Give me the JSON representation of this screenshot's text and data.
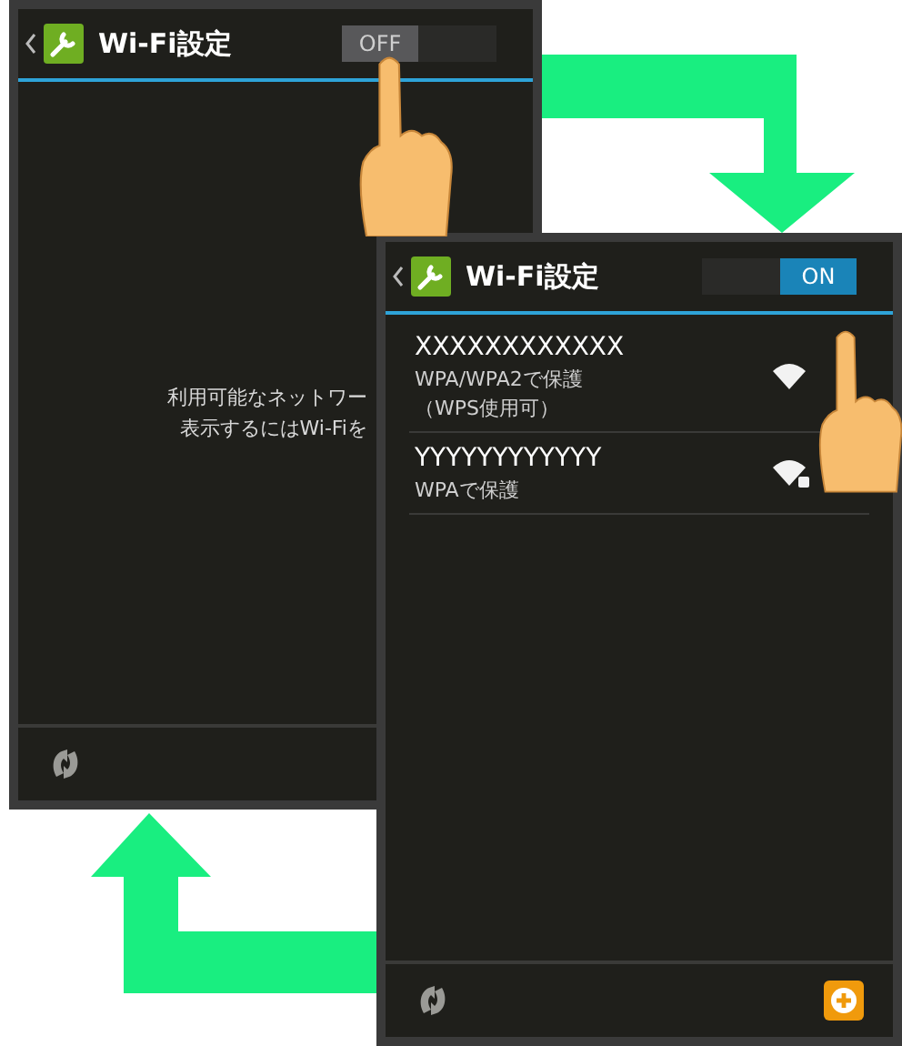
{
  "screens": [
    {
      "title": "Wi-Fi設定",
      "switch": {
        "label": "OFF",
        "on": false
      },
      "message": [
        "利用可能なネットワー",
        "表示するにはWi-Fiを"
      ],
      "add_button": false
    },
    {
      "title": "Wi-Fi設定",
      "switch": {
        "label": "ON",
        "on": true
      },
      "networks": [
        {
          "ssid": "XXXXXXXXXXXX",
          "security": "WPA/WPA2で保護",
          "note": "（WPS使用可）",
          "locked": false
        },
        {
          "ssid": "YYYYYYYYYYYY",
          "security": "WPAで保護",
          "locked": true
        }
      ],
      "add_button": true
    }
  ]
}
